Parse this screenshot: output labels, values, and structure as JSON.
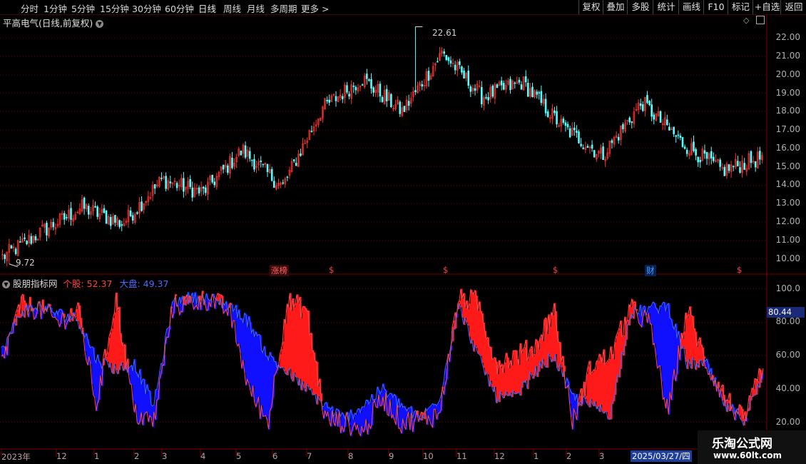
{
  "toolbar": {
    "periods": [
      "分时",
      "1分钟",
      "5分钟",
      "15分钟",
      "30分钟",
      "60分钟",
      "日线",
      "周线",
      "月线",
      "多周期",
      "更多 >"
    ],
    "active_period": "日线",
    "right_buttons": [
      "复权",
      "叠加",
      "多股",
      "统计",
      "画线",
      "F10",
      "标记",
      "+自选",
      "返回"
    ]
  },
  "main_chart": {
    "title": "平高电气(日线,前复权)",
    "high_label": "22.61",
    "low_label": "9.72",
    "price_axis": [
      "22.00",
      "21.00",
      "20.00",
      "19.00",
      "18.00",
      "17.00",
      "16.00",
      "15.00",
      "14.00",
      "13.00",
      "12.00",
      "11.00",
      "10.00"
    ],
    "markers": [
      {
        "text": "涨榜",
        "color": "#ff6060"
      },
      {
        "text": "$",
        "color": "#ff4040"
      },
      {
        "text": "$",
        "color": "#ff4040"
      },
      {
        "text": "$",
        "color": "#ff4040"
      },
      {
        "text": "财",
        "color": "#40a0ff"
      },
      {
        "text": "$",
        "color": "#ff4040"
      }
    ]
  },
  "indicator": {
    "name": "股朋指标网",
    "stock_label": "个股: 52.37",
    "market_label": "大盘: 49.37",
    "axis": [
      "100.0",
      "80.00",
      "60.00",
      "40.00",
      "20.00"
    ],
    "current_value": "80.44"
  },
  "date_axis": {
    "labels": [
      "2023年",
      "12",
      "1",
      "2",
      "3",
      "4",
      "5",
      "6",
      "7",
      "8",
      "9",
      "10",
      "11",
      "12",
      "1",
      "2",
      "3"
    ],
    "cursor_date": "2025/03/27/四"
  },
  "watermark": {
    "title": "乐淘公式网",
    "url": "www.60lt.com"
  },
  "colors": {
    "up": "#ff3232",
    "down": "#54ffff",
    "stock_fill": "#ff1a1a",
    "market_fill": "#1010ff",
    "grid": "#6a0000"
  },
  "chart_data": {
    "type": "candlestick",
    "price_range": [
      9.4,
      22.9
    ],
    "close_trend": [
      [
        "2023-11",
        10.1
      ],
      [
        "2023-12",
        11.5
      ],
      [
        "2024-01",
        12.8
      ],
      [
        "2024-02",
        11.9
      ],
      [
        "2024-03",
        14.3
      ],
      [
        "2024-04",
        13.6
      ],
      [
        "2024-05",
        15.9
      ],
      [
        "2024-06",
        13.9
      ],
      [
        "2024-07",
        18.2
      ],
      [
        "2024-08",
        19.8
      ],
      [
        "2024-09",
        18.0
      ],
      [
        "2024-10",
        21.2
      ],
      [
        "2024-11",
        18.8
      ],
      [
        "2024-12",
        19.6
      ],
      [
        "2025-01",
        17.2
      ],
      [
        "2025-02",
        15.6
      ],
      [
        "2025-03",
        18.5
      ],
      [
        "2025-04",
        16.3
      ],
      [
        "2025-05",
        14.8
      ],
      [
        "2025-06",
        15.5
      ]
    ],
    "high": 22.61,
    "low": 9.72,
    "indicator_range": [
      10,
      105
    ],
    "indicator_latest": {
      "stock": 52.37,
      "market": 49.37
    }
  }
}
